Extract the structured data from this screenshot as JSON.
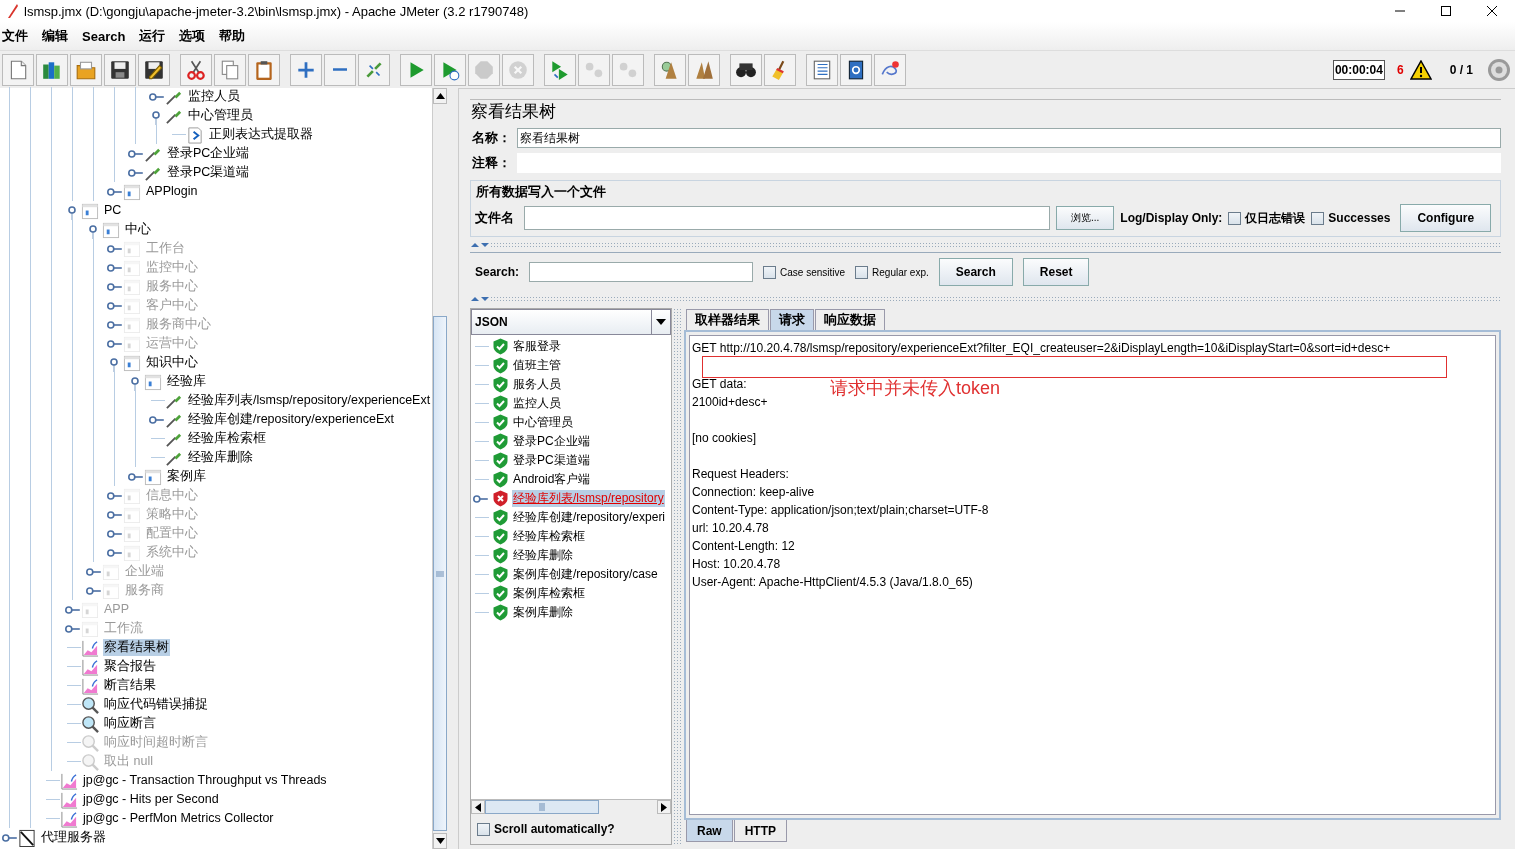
{
  "window": {
    "title": "lsmsp.jmx (D:\\gongju\\apache-jmeter-3.2\\bin\\lsmsp.jmx) - Apache JMeter (3.2 r1790748)"
  },
  "menu": [
    "文件",
    "编辑",
    "Search",
    "运行",
    "选项",
    "帮助"
  ],
  "toolbar": {
    "groups": [
      {
        "items": [
          {
            "kind": "new",
            "disabled": false
          },
          {
            "kind": "templates",
            "disabled": false
          },
          {
            "kind": "open",
            "disabled": false
          },
          {
            "kind": "save",
            "disabled": false
          },
          {
            "kind": "save-as",
            "disabled": false
          }
        ]
      },
      {
        "items": [
          {
            "kind": "cut",
            "disabled": false
          },
          {
            "kind": "copy",
            "disabled": false
          },
          {
            "kind": "paste",
            "disabled": false
          }
        ]
      },
      {
        "items": [
          {
            "kind": "expand",
            "disabled": false
          },
          {
            "kind": "collapse",
            "disabled": false
          },
          {
            "kind": "toggle",
            "disabled": false
          }
        ]
      },
      {
        "items": [
          {
            "kind": "start",
            "disabled": false
          },
          {
            "kind": "start-no-pauses",
            "disabled": false
          },
          {
            "kind": "stop",
            "disabled": true
          },
          {
            "kind": "shutdown",
            "disabled": true
          }
        ]
      },
      {
        "items": [
          {
            "kind": "remote-start",
            "disabled": false
          },
          {
            "kind": "remote-stop",
            "disabled": true
          },
          {
            "kind": "remote-shutdown",
            "disabled": true
          }
        ]
      },
      {
        "items": [
          {
            "kind": "clear",
            "disabled": false
          },
          {
            "kind": "clear-all",
            "disabled": false
          }
        ]
      },
      {
        "items": [
          {
            "kind": "search",
            "disabled": false
          },
          {
            "kind": "reset-search",
            "disabled": false
          }
        ]
      },
      {
        "items": [
          {
            "kind": "function-helper",
            "disabled": false
          },
          {
            "kind": "help",
            "disabled": false
          },
          {
            "kind": "log",
            "disabled": false
          }
        ]
      }
    ],
    "elapsed": "00:00:04",
    "error_count": "6",
    "threads": "0 / 1"
  },
  "tree": {
    "nodes": [
      {
        "children": [
          {
            "children": [
              {
                "children": [
                  {
                    "children": [
                      {
                        "children": [
                          {
                            "children": [
                              {
                                "children": [
                                  {
                                    "label": "监控人员",
                                    "kind": "sampler",
                                    "expanded": false,
                                    "disabled": false,
                                    "selected": false
                                  },
                                  {
                                    "label": "中心管理员",
                                    "kind": "sampler",
                                    "expanded": true,
                                    "disabled": false,
                                    "selected": false,
                                    "children": [
                                      {
                                        "label": "正则表达式提取器",
                                        "kind": "extractor",
                                        "disabled": false,
                                        "selected": false
                                      }
                                    ]
                                  }
                                ]
                              },
                              {
                                "label": "登录PC企业端",
                                "kind": "sampler",
                                "expanded": false,
                                "disabled": false,
                                "selected": false
                              },
                              {
                                "label": "登录PC渠道端",
                                "kind": "sampler",
                                "expanded": false,
                                "disabled": false,
                                "selected": false
                              }
                            ]
                          },
                          {
                            "label": "APPlogin",
                            "kind": "controller",
                            "expanded": false,
                            "disabled": false,
                            "selected": false
                          }
                        ]
                      }
                    ]
                  },
                  {
                    "label": "PC",
                    "kind": "controller",
                    "expanded": true,
                    "disabled": false,
                    "selected": false,
                    "children": [
                      {
                        "label": "中心",
                        "kind": "controller",
                        "expanded": true,
                        "disabled": false,
                        "selected": false,
                        "children": [
                          {
                            "label": "工作台",
                            "kind": "controller",
                            "expanded": false,
                            "disabled": true,
                            "selected": false
                          },
                          {
                            "label": "监控中心",
                            "kind": "controller",
                            "expanded": false,
                            "disabled": true,
                            "selected": false
                          },
                          {
                            "label": "服务中心",
                            "kind": "controller",
                            "expanded": false,
                            "disabled": true,
                            "selected": false
                          },
                          {
                            "label": "客户中心",
                            "kind": "controller",
                            "expanded": false,
                            "disabled": true,
                            "selected": false
                          },
                          {
                            "label": "服务商中心",
                            "kind": "controller",
                            "expanded": false,
                            "disabled": true,
                            "selected": false
                          },
                          {
                            "label": "运营中心",
                            "kind": "controller",
                            "expanded": false,
                            "disabled": true,
                            "selected": false
                          },
                          {
                            "label": "知识中心",
                            "kind": "controller",
                            "expanded": true,
                            "disabled": false,
                            "selected": false,
                            "children": [
                              {
                                "label": "经验库",
                                "kind": "controller",
                                "expanded": true,
                                "disabled": false,
                                "selected": false,
                                "children": [
                                  {
                                    "label": "经验库列表/lsmsp/repository/experienceExt",
                                    "kind": "sampler",
                                    "disabled": false,
                                    "selected": false
                                  },
                                  {
                                    "label": "经验库创建/repository/experienceExt",
                                    "kind": "sampler",
                                    "expanded": false,
                                    "disabled": false,
                                    "selected": false
                                  },
                                  {
                                    "label": "经验库检索框",
                                    "kind": "sampler",
                                    "disabled": false,
                                    "selected": false
                                  },
                                  {
                                    "label": "经验库删除",
                                    "kind": "sampler",
                                    "disabled": false,
                                    "selected": false
                                  }
                                ]
                              },
                              {
                                "label": "案例库",
                                "kind": "controller",
                                "expanded": false,
                                "disabled": false,
                                "selected": false
                              }
                            ]
                          },
                          {
                            "label": "信息中心",
                            "kind": "controller",
                            "expanded": false,
                            "disabled": true,
                            "selected": false
                          },
                          {
                            "label": "策略中心",
                            "kind": "controller",
                            "expanded": false,
                            "disabled": true,
                            "selected": false
                          },
                          {
                            "label": "配置中心",
                            "kind": "controller",
                            "expanded": false,
                            "disabled": true,
                            "selected": false
                          },
                          {
                            "label": "系统中心",
                            "kind": "controller",
                            "expanded": false,
                            "disabled": true,
                            "selected": false
                          }
                        ]
                      },
                      {
                        "label": "企业端",
                        "kind": "controller",
                        "expanded": false,
                        "disabled": true,
                        "selected": false
                      },
                      {
                        "label": "服务商",
                        "kind": "controller",
                        "expanded": false,
                        "disabled": true,
                        "selected": false
                      }
                    ]
                  },
                  {
                    "label": "APP",
                    "kind": "controller",
                    "expanded": false,
                    "disabled": true,
                    "selected": false
                  },
                  {
                    "label": "工作流",
                    "kind": "controller",
                    "expanded": false,
                    "disabled": true,
                    "selected": false
                  },
                  {
                    "label": "察看结果树",
                    "kind": "listener",
                    "disabled": false,
                    "selected": true
                  },
                  {
                    "label": "聚合报告",
                    "kind": "listener",
                    "disabled": false,
                    "selected": false
                  },
                  {
                    "label": "断言结果",
                    "kind": "listener",
                    "disabled": false,
                    "selected": false
                  },
                  {
                    "label": "响应代码错误捕捉",
                    "kind": "assertion",
                    "disabled": false,
                    "selected": false
                  },
                  {
                    "label": "响应断言",
                    "kind": "assertion",
                    "disabled": false,
                    "selected": false
                  },
                  {
                    "label": "响应时间超时断言",
                    "kind": "assertion",
                    "disabled": true,
                    "selected": false
                  },
                  {
                    "label": "取出 null",
                    "kind": "assertion",
                    "disabled": true,
                    "selected": false
                  }
                ]
              },
              {
                "label": "jp@gc - Transaction Throughput vs Threads",
                "kind": "listener",
                "disabled": false,
                "selected": false
              },
              {
                "label": "jp@gc - Hits per Second",
                "kind": "listener",
                "disabled": false,
                "selected": false
              },
              {
                "label": "jp@gc - PerfMon Metrics Collector",
                "kind": "listener",
                "disabled": false,
                "selected": false
              }
            ]
          }
        ]
      },
      {
        "label": "代理服务器",
        "kind": "workbench",
        "expanded": false,
        "disabled": false,
        "selected": false
      }
    ]
  },
  "panel": {
    "title": "察看结果树",
    "name_label": "名称：",
    "name_value": "察看结果树",
    "comment_label": "注释：",
    "file_group": "所有数据写入一个文件",
    "filename_label": "文件名",
    "browse": "浏览...",
    "log_display": "Log/Display Only:",
    "errors_only": {
      "label": "仅日志错误",
      "checked": false
    },
    "successes": {
      "label": "Successes",
      "checked": false
    },
    "configure": "Configure"
  },
  "search": {
    "label": "Search:",
    "case_sensitive": {
      "label": "Case sensitive",
      "checked": false
    },
    "regex": {
      "label": "Regular exp.",
      "checked": false
    },
    "search_button": "Search",
    "reset_button": "Reset"
  },
  "renderer": "JSON",
  "results": [
    {
      "label": "客服登录",
      "failed": false,
      "selected": false,
      "expandable": false
    },
    {
      "label": "值班主管",
      "failed": false,
      "selected": false,
      "expandable": false
    },
    {
      "label": "服务人员",
      "failed": false,
      "selected": false,
      "expandable": false
    },
    {
      "label": "监控人员",
      "failed": false,
      "selected": false,
      "expandable": false
    },
    {
      "label": "中心管理员",
      "failed": false,
      "selected": false,
      "expandable": false
    },
    {
      "label": "登录PC企业端",
      "failed": false,
      "selected": false,
      "expandable": false
    },
    {
      "label": "登录PC渠道端",
      "failed": false,
      "selected": false,
      "expandable": false
    },
    {
      "label": "Android客户端",
      "failed": false,
      "selected": false,
      "expandable": false
    },
    {
      "label": "经验库列表/lsmsp/repository",
      "failed": true,
      "selected": true,
      "expandable": true
    },
    {
      "label": "经验库创建/repository/experi",
      "failed": false,
      "selected": false,
      "expandable": false
    },
    {
      "label": "经验库检索框",
      "failed": false,
      "selected": false,
      "expandable": false
    },
    {
      "label": "经验库删除",
      "failed": false,
      "selected": false,
      "expandable": false
    },
    {
      "label": "案例库创建/repository/case",
      "failed": false,
      "selected": false,
      "expandable": false
    },
    {
      "label": "案例库检索框",
      "failed": false,
      "selected": false,
      "expandable": false
    },
    {
      "label": "案例库删除",
      "failed": false,
      "selected": false,
      "expandable": false
    }
  ],
  "scroll_automatically": {
    "label": "Scroll automatically?",
    "checked": false
  },
  "tabs": [
    {
      "label": "取样器结果",
      "selected": false
    },
    {
      "label": "请求",
      "selected": true
    },
    {
      "label": "响应数据",
      "selected": false
    }
  ],
  "request_text": [
    [
      "GET http://10.20.4.78/lsmsp/repository/experienceExt?filter_EQI_createuser=2&iDisplayLength=10&iDisplayStart=0&sort=id+desc+"
    ],
    [
      "GET data:",
      "2100id+desc+"
    ],
    [
      "[no cookies]"
    ],
    [
      "Request Headers:",
      "Connection: keep-alive",
      "Content-Type: application/json;text/plain;charset=UTF-8",
      "url: 10.20.4.78",
      "Content-Length: 12",
      "Host: 10.20.4.78",
      "User-Agent: Apache-HttpClient/4.5.3 (Java/1.8.0_65)"
    ]
  ],
  "annotation": {
    "text": "请求中并未传入token"
  },
  "bottom_tabs": [
    {
      "label": "Raw",
      "selected": true
    },
    {
      "label": "HTTP",
      "selected": false
    }
  ]
}
